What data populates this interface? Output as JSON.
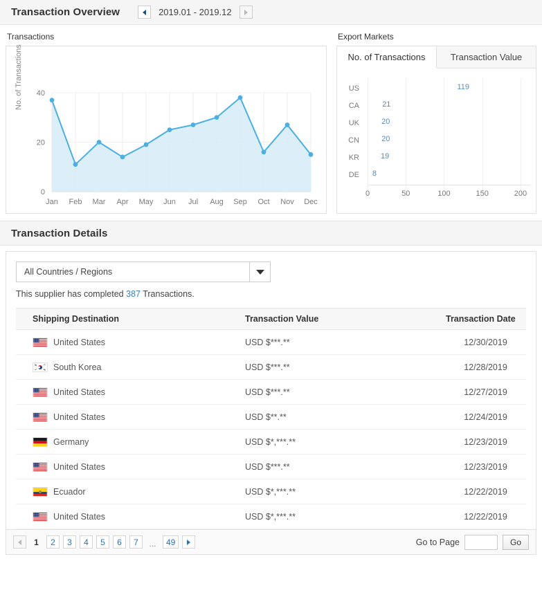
{
  "overview": {
    "title": "Transaction Overview",
    "period_label": "2019.01 - 2019.12",
    "prev_icon": "triangle-left-icon",
    "next_icon": "triangle-right-icon"
  },
  "transactions_chart": {
    "caption": "Transactions"
  },
  "export_markets": {
    "caption": "Export Markets",
    "tabs": [
      {
        "label": "No. of Transactions",
        "active": true
      },
      {
        "label": "Transaction Value",
        "active": false
      }
    ]
  },
  "details": {
    "title": "Transaction Details",
    "filter": {
      "selected": "All Countries / Regions",
      "caret_icon": "chevron-down-icon"
    },
    "summary_prefix": "This supplier has completed ",
    "summary_count": "387",
    "summary_suffix": " Transactions.",
    "columns": [
      "Shipping Destination",
      "Transaction Value",
      "Transaction Date"
    ],
    "rows": [
      {
        "country": "United States",
        "flag": "us",
        "value": "USD $***.**",
        "date": "12/30/2019"
      },
      {
        "country": "South Korea",
        "flag": "kr",
        "value": "USD $***.**",
        "date": "12/28/2019"
      },
      {
        "country": "United States",
        "flag": "us",
        "value": "USD $***.**",
        "date": "12/27/2019"
      },
      {
        "country": "United States",
        "flag": "us",
        "value": "USD $**.**",
        "date": "12/24/2019"
      },
      {
        "country": "Germany",
        "flag": "de",
        "value": "USD $*,***.**",
        "date": "12/23/2019"
      },
      {
        "country": "United States",
        "flag": "us",
        "value": "USD $***.**",
        "date": "12/23/2019"
      },
      {
        "country": "Ecuador",
        "flag": "ec",
        "value": "USD $*,***.**",
        "date": "12/22/2019"
      },
      {
        "country": "United States",
        "flag": "us",
        "value": "USD $*,***.**",
        "date": "12/22/2019"
      }
    ]
  },
  "pager": {
    "prev_icon": "triangle-left-icon",
    "next_icon": "triangle-right-icon",
    "pages": [
      "1",
      "2",
      "3",
      "4",
      "5",
      "6",
      "7",
      "...",
      "49"
    ],
    "current_page": "1",
    "goto_label": "Go to Page",
    "goto_value": "",
    "go_label": "Go"
  },
  "colors": {
    "accent": "#4cafe0",
    "line": "#4cafe0",
    "area": "#d6ecf8",
    "link": "#2f72b5",
    "header_bg": "#f5f5f5"
  },
  "chart_data": [
    {
      "type": "area",
      "title": "Transactions",
      "xlabel": "",
      "ylabel": "No. of Transactions",
      "categories": [
        "Jan",
        "Feb",
        "Mar",
        "Apr",
        "May",
        "Jun",
        "Jul",
        "Aug",
        "Sep",
        "Oct",
        "Nov",
        "Dec"
      ],
      "values": [
        37,
        11,
        20,
        14,
        19,
        25,
        27,
        30,
        38,
        16,
        27,
        15
      ],
      "ylim": [
        0,
        40
      ],
      "yticks": [
        0,
        20,
        40
      ],
      "grid": true,
      "legend": "none",
      "series": [
        {
          "name": "No. of Transactions",
          "values": [
            37,
            11,
            20,
            14,
            19,
            25,
            27,
            30,
            38,
            16,
            27,
            15
          ]
        }
      ]
    },
    {
      "type": "bar",
      "orientation": "horizontal",
      "title": "Export Markets",
      "subtitle": "No. of Transactions",
      "xlabel": "",
      "ylabel": "",
      "categories": [
        "US",
        "CA",
        "UK",
        "CN",
        "KR",
        "DE"
      ],
      "values": [
        119,
        21,
        20,
        20,
        19,
        8
      ],
      "xlim": [
        0,
        220
      ],
      "xticks": [
        0,
        50,
        100,
        150,
        200
      ],
      "grid": true,
      "legend": "none"
    }
  ]
}
